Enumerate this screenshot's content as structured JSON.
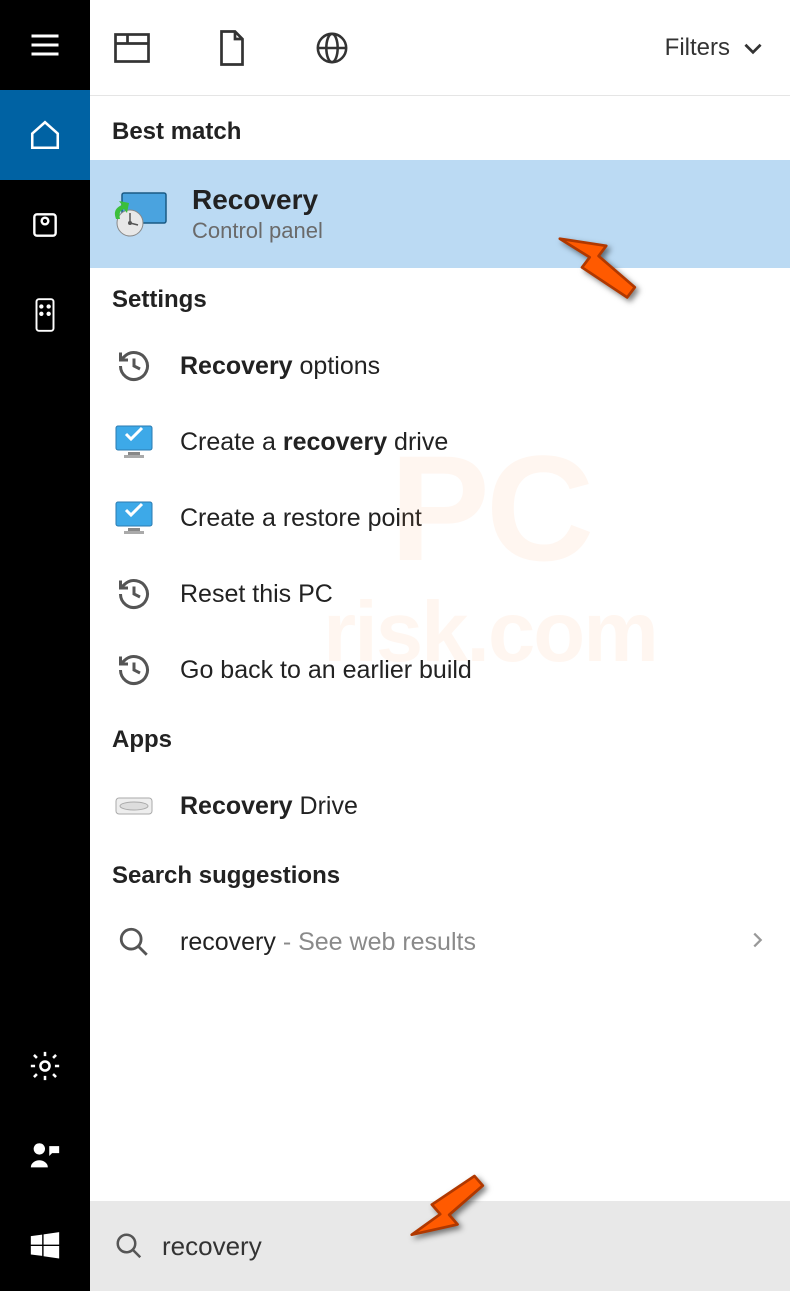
{
  "filters_label": "Filters",
  "sections": {
    "best_match": "Best match",
    "settings": "Settings",
    "apps": "Apps",
    "suggestions": "Search suggestions"
  },
  "best_result": {
    "title": "Recovery",
    "sub": "Control panel"
  },
  "settings_items": [
    {
      "bold": "Recovery",
      "rest": " options",
      "icon": "history"
    },
    {
      "pre": "Create a ",
      "bold": "recovery",
      "rest": " drive",
      "icon": "monitor"
    },
    {
      "plain": "Create a restore point",
      "icon": "monitor"
    },
    {
      "plain": "Reset this PC",
      "icon": "history"
    },
    {
      "plain": "Go back to an earlier build",
      "icon": "history"
    }
  ],
  "apps_items": [
    {
      "bold": "Recovery",
      "rest": " Drive",
      "icon": "disk"
    }
  ],
  "suggestion": {
    "query": "recovery",
    "hint": " - See web results"
  },
  "search_value": "recovery",
  "watermark": {
    "line1": "PC",
    "line2": "risk.com"
  }
}
